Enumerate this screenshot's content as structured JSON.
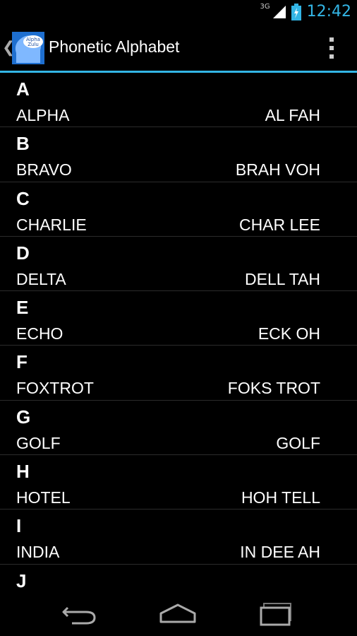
{
  "status_bar": {
    "network": "3G",
    "time": "12:42"
  },
  "action_bar": {
    "title": "Phonetic Alphabet",
    "icon_text_top": "Alpha",
    "icon_text_bottom": "Zulu"
  },
  "colors": {
    "accent": "#33b5e5",
    "icon_blue": "#1e6fd0"
  },
  "items": [
    {
      "letter": "A",
      "word": "ALPHA",
      "pronunciation": "AL FAH"
    },
    {
      "letter": "B",
      "word": "BRAVO",
      "pronunciation": "BRAH VOH"
    },
    {
      "letter": "C",
      "word": "CHARLIE",
      "pronunciation": "CHAR LEE"
    },
    {
      "letter": "D",
      "word": "DELTA",
      "pronunciation": "DELL TAH"
    },
    {
      "letter": "E",
      "word": "ECHO",
      "pronunciation": "ECK OH"
    },
    {
      "letter": "F",
      "word": "FOXTROT",
      "pronunciation": "FOKS TROT"
    },
    {
      "letter": "G",
      "word": "GOLF",
      "pronunciation": "GOLF"
    },
    {
      "letter": "H",
      "word": "HOTEL",
      "pronunciation": "HOH TELL"
    },
    {
      "letter": "I",
      "word": "INDIA",
      "pronunciation": "IN DEE AH"
    },
    {
      "letter": "J",
      "word": "",
      "pronunciation": ""
    }
  ],
  "nav": {
    "back_icon": "back-arrow-icon",
    "home_icon": "home-icon",
    "recents_icon": "recent-apps-icon"
  }
}
